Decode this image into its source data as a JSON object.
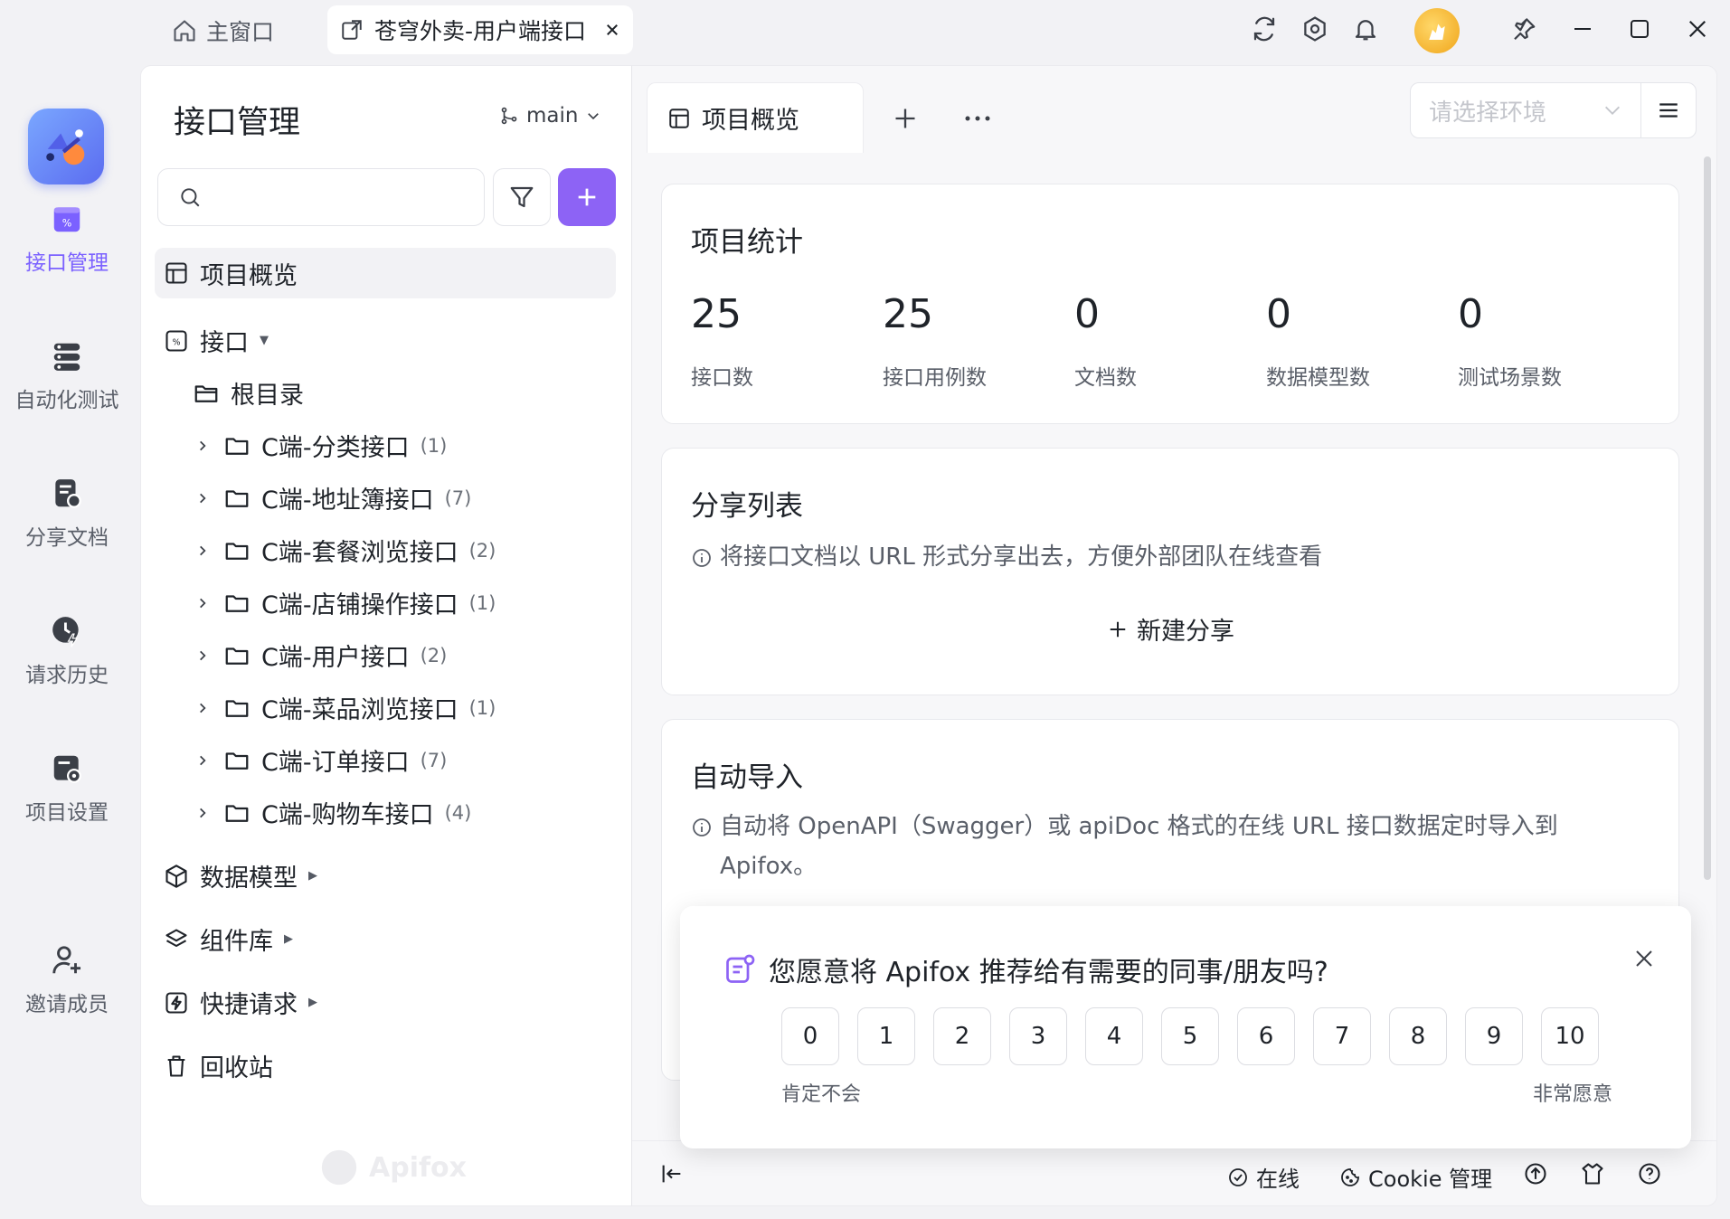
{
  "titlebar": {
    "home_tab": "主窗口",
    "active_tab": "苍穹外卖-用户端接口"
  },
  "rail": {
    "items": [
      {
        "label": "接口管理",
        "icon": "api-management-icon",
        "active": true
      },
      {
        "label": "自动化测试",
        "icon": "automation-test-icon",
        "active": false
      },
      {
        "label": "分享文档",
        "icon": "share-doc-icon",
        "active": false
      },
      {
        "label": "请求历史",
        "icon": "history-icon",
        "active": false
      },
      {
        "label": "项目设置",
        "icon": "project-settings-icon",
        "active": false
      },
      {
        "label": "邀请成员",
        "icon": "invite-member-icon",
        "active": false
      }
    ]
  },
  "panel": {
    "title": "接口管理",
    "branch": "main",
    "search_placeholder": "",
    "overview": "项目概览",
    "api_group": "接口",
    "root": "根目录",
    "folders": [
      {
        "name": "C端-分类接口",
        "count": "(1)"
      },
      {
        "name": "C端-地址簿接口",
        "count": "(7)"
      },
      {
        "name": "C端-套餐浏览接口",
        "count": "(2)"
      },
      {
        "name": "C端-店铺操作接口",
        "count": "(1)"
      },
      {
        "name": "C端-用户接口",
        "count": "(2)"
      },
      {
        "name": "C端-菜品浏览接口",
        "count": "(1)"
      },
      {
        "name": "C端-订单接口",
        "count": "(7)"
      },
      {
        "name": "C端-购物车接口",
        "count": "(4)"
      }
    ],
    "data_model": "数据模型",
    "components": "组件库",
    "quick_request": "快捷请求",
    "recycle": "回收站",
    "watermark": "Apifox"
  },
  "main": {
    "tab": "项目概览",
    "env_placeholder": "请选择环境",
    "stats": {
      "title": "项目统计",
      "items": [
        {
          "value": "25",
          "label": "接口数"
        },
        {
          "value": "25",
          "label": "接口用例数"
        },
        {
          "value": "0",
          "label": "文档数"
        },
        {
          "value": "0",
          "label": "数据模型数"
        },
        {
          "value": "0",
          "label": "测试场景数"
        }
      ]
    },
    "share": {
      "title": "分享列表",
      "desc": "将接口文档以 URL 形式分享出去，方便外部团队在线查看",
      "new_label": "新建分享"
    },
    "auto_import": {
      "title": "自动导入",
      "desc": "自动将 OpenAPI（Swagger）或 apiDoc 格式的在线 URL 接口数据定时导入到 Apifox。"
    },
    "bottom": {
      "online": "在线",
      "cookie": "Cookie 管理"
    }
  },
  "nps": {
    "question": "您愿意将 Apifox 推荐给有需要的同事/朋友吗?",
    "scores": [
      "0",
      "1",
      "2",
      "3",
      "4",
      "5",
      "6",
      "7",
      "8",
      "9",
      "10"
    ],
    "min_label": "肯定不会",
    "max_label": "非常愿意"
  },
  "colors": {
    "accent": "#8d63f5",
    "active_rail": "#7b61ff"
  }
}
